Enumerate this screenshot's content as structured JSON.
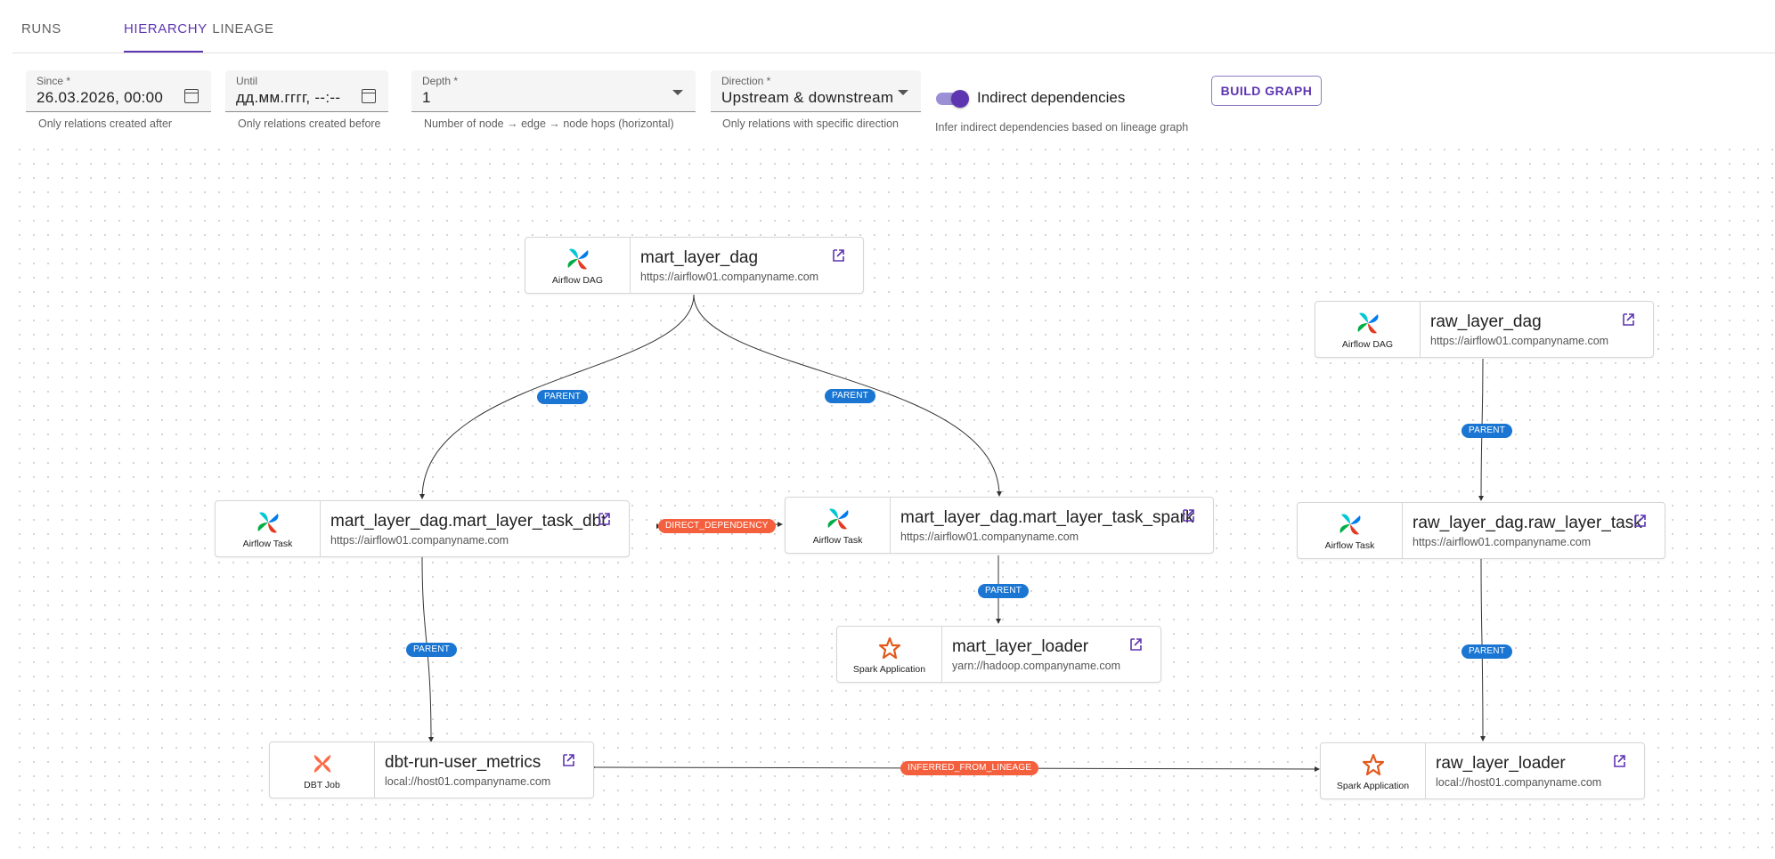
{
  "tabs": [
    {
      "label": "RUNS",
      "active": false
    },
    {
      "label": "HIERARCHY",
      "active": true
    },
    {
      "label": "LINEAGE",
      "active": false
    }
  ],
  "filters": {
    "since": {
      "label": "Since *",
      "value": "26.03.2026, 00:00",
      "helper": "Only relations created after"
    },
    "until": {
      "label": "Until",
      "value": "дд.мм.гггг, --:--",
      "helper": "Only relations created before"
    },
    "depth": {
      "label": "Depth *",
      "value": "1",
      "helper": "Number of node → edge → node hops (horizontal)"
    },
    "direction": {
      "label": "Direction *",
      "value": "Upstream & downstream",
      "helper": "Only relations with specific direction"
    },
    "indirect": {
      "label": "Indirect dependencies",
      "enabled": true,
      "helper": "Infer indirect dependencies based on lineage graph"
    },
    "build_label": "BUILD GRAPH"
  },
  "colors": {
    "accent": "#5e35b1",
    "parent_badge": "#1a76d2",
    "dependency_badge": "#f4603e"
  },
  "nodes": {
    "mart_dag": {
      "type": "Airflow DAG",
      "icon": "airflow-icon",
      "name": "mart_layer_dag",
      "url": "https://airflow01.companyname.com"
    },
    "raw_dag": {
      "type": "Airflow DAG",
      "icon": "airflow-icon",
      "name": "raw_layer_dag",
      "url": "https://airflow01.companyname.com"
    },
    "task_dbt": {
      "type": "Airflow Task",
      "icon": "airflow-icon",
      "name": "mart_layer_dag.mart_layer_task_dbt",
      "url": "https://airflow01.companyname.com"
    },
    "task_spark": {
      "type": "Airflow Task",
      "icon": "airflow-icon",
      "name": "mart_layer_dag.mart_layer_task_spark",
      "url": "https://airflow01.companyname.com"
    },
    "raw_task": {
      "type": "Airflow Task",
      "icon": "airflow-icon",
      "name": "raw_layer_dag.raw_layer_task",
      "url": "https://airflow01.companyname.com"
    },
    "mart_loader": {
      "type": "Spark Application",
      "icon": "spark-icon",
      "name": "mart_layer_loader",
      "url": "yarn://hadoop.companyname.com"
    },
    "dbt_job": {
      "type": "DBT Job",
      "icon": "dbt-icon",
      "name": "dbt-run-user_metrics",
      "url": "local://host01.companyname.com"
    },
    "raw_loader": {
      "type": "Spark Application",
      "icon": "spark-icon",
      "name": "raw_layer_loader",
      "url": "local://host01.companyname.com"
    }
  },
  "edge_labels": {
    "parent": "PARENT",
    "direct": "DIRECT_DEPENDENCY",
    "inferred": "INFERRED_FROM_LINEAGE"
  }
}
